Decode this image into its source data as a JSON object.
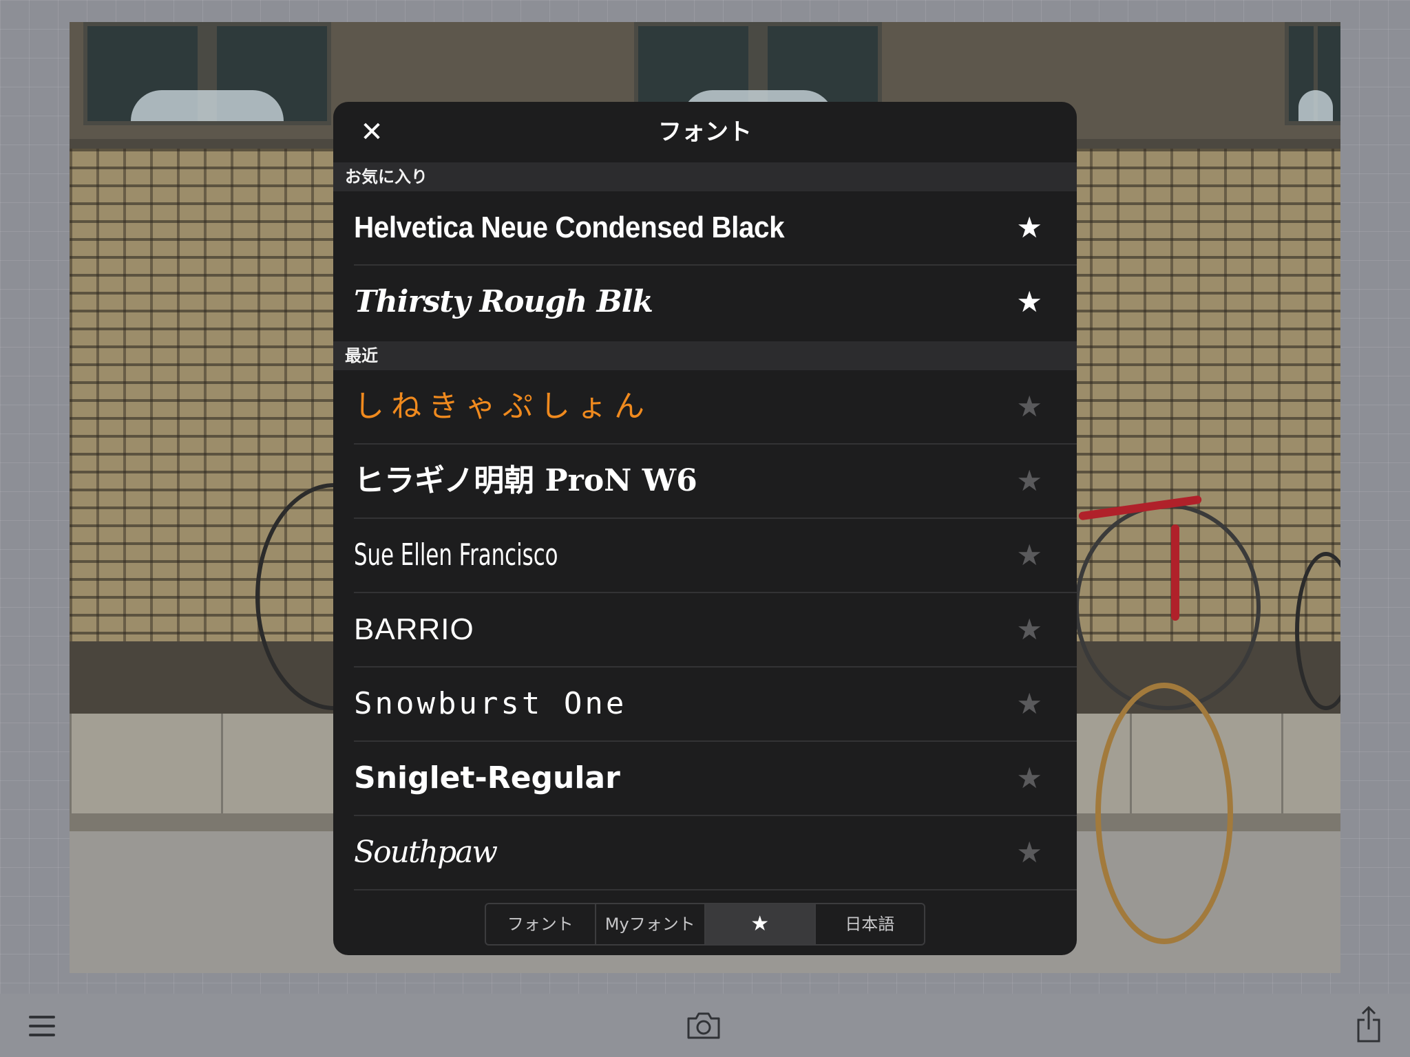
{
  "dialog": {
    "title": "フォント",
    "close_label": "✕"
  },
  "sections": {
    "favorites": "お気に入り",
    "recent": "最近"
  },
  "favorites": [
    {
      "name": "Helvetica Neue Condensed Black",
      "starred": true
    },
    {
      "name": "Thirsty Rough Blk",
      "starred": true
    }
  ],
  "recent": [
    {
      "name": "しねきゃぷしょん",
      "starred": false
    },
    {
      "name": "ヒラギノ明朝 ProN W6",
      "starred": false
    },
    {
      "name": "Sue Ellen Francisco",
      "starred": false
    },
    {
      "name": "BARRIO",
      "starred": false
    },
    {
      "name": "Snowburst One",
      "starred": false
    },
    {
      "name": "Sniglet-Regular",
      "starred": false
    },
    {
      "name": "Southpaw",
      "starred": false
    }
  ],
  "star_glyph": "★",
  "segments": [
    "フォント",
    "Myフォント",
    "★",
    "日本語"
  ],
  "active_segment": 2,
  "colors": {
    "dialog_bg": "#1d1d1e",
    "section_bg": "#2c2c2e",
    "accent_orange": "#f08a1e",
    "star_on": "#ffffff",
    "star_off": "#5a5a5c"
  },
  "toolbar": {
    "icons": [
      "menu-icon",
      "camera-icon",
      "share-icon"
    ]
  }
}
